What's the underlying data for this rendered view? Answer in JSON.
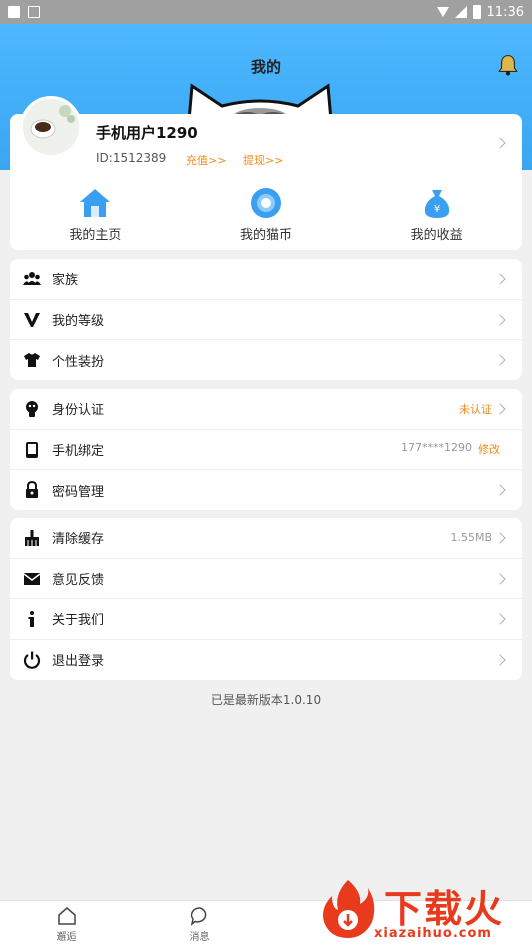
{
  "status_bar": {
    "time": "11:36"
  },
  "header": {
    "title": "我的"
  },
  "profile": {
    "username": "手机用户1290",
    "user_id": "ID:1512389",
    "recharge_label": "充值>>",
    "withdraw_label": "提现>>"
  },
  "quick_links": [
    {
      "label": "我的主页",
      "icon": "home-icon"
    },
    {
      "label": "我的猫币",
      "icon": "coin-icon"
    },
    {
      "label": "我的收益",
      "icon": "money-bag-icon"
    }
  ],
  "menu_group_1": [
    {
      "label": "家族",
      "icon": "people-icon"
    },
    {
      "label": "我的等级",
      "icon": "level-v-icon"
    },
    {
      "label": "个性装扮",
      "icon": "tshirt-icon"
    }
  ],
  "menu_group_2": [
    {
      "label": "身份认证",
      "icon": "id-icon",
      "value": "未认证"
    },
    {
      "label": "手机绑定",
      "icon": "phone-icon",
      "value": "177****1290",
      "action": "修改"
    },
    {
      "label": "密码管理",
      "icon": "lock-icon"
    }
  ],
  "menu_group_3": [
    {
      "label": "清除缓存",
      "icon": "broom-icon",
      "value": "1.55MB"
    },
    {
      "label": "意见反馈",
      "icon": "mail-icon"
    },
    {
      "label": "关于我们",
      "icon": "info-icon"
    },
    {
      "label": "退出登录",
      "icon": "power-icon"
    }
  ],
  "version_text": "已是最新版本1.0.10",
  "bottom_nav": [
    {
      "label": "邂逅",
      "icon": "home-outline-icon"
    },
    {
      "label": "消息",
      "icon": "chat-icon"
    }
  ],
  "watermark": {
    "text": "下载火",
    "sub": "xiazaihuo.com"
  },
  "colors": {
    "header_blue": "#39a6f2",
    "accent_orange": "#f08c1c",
    "watermark_red": "#e83a1c"
  }
}
